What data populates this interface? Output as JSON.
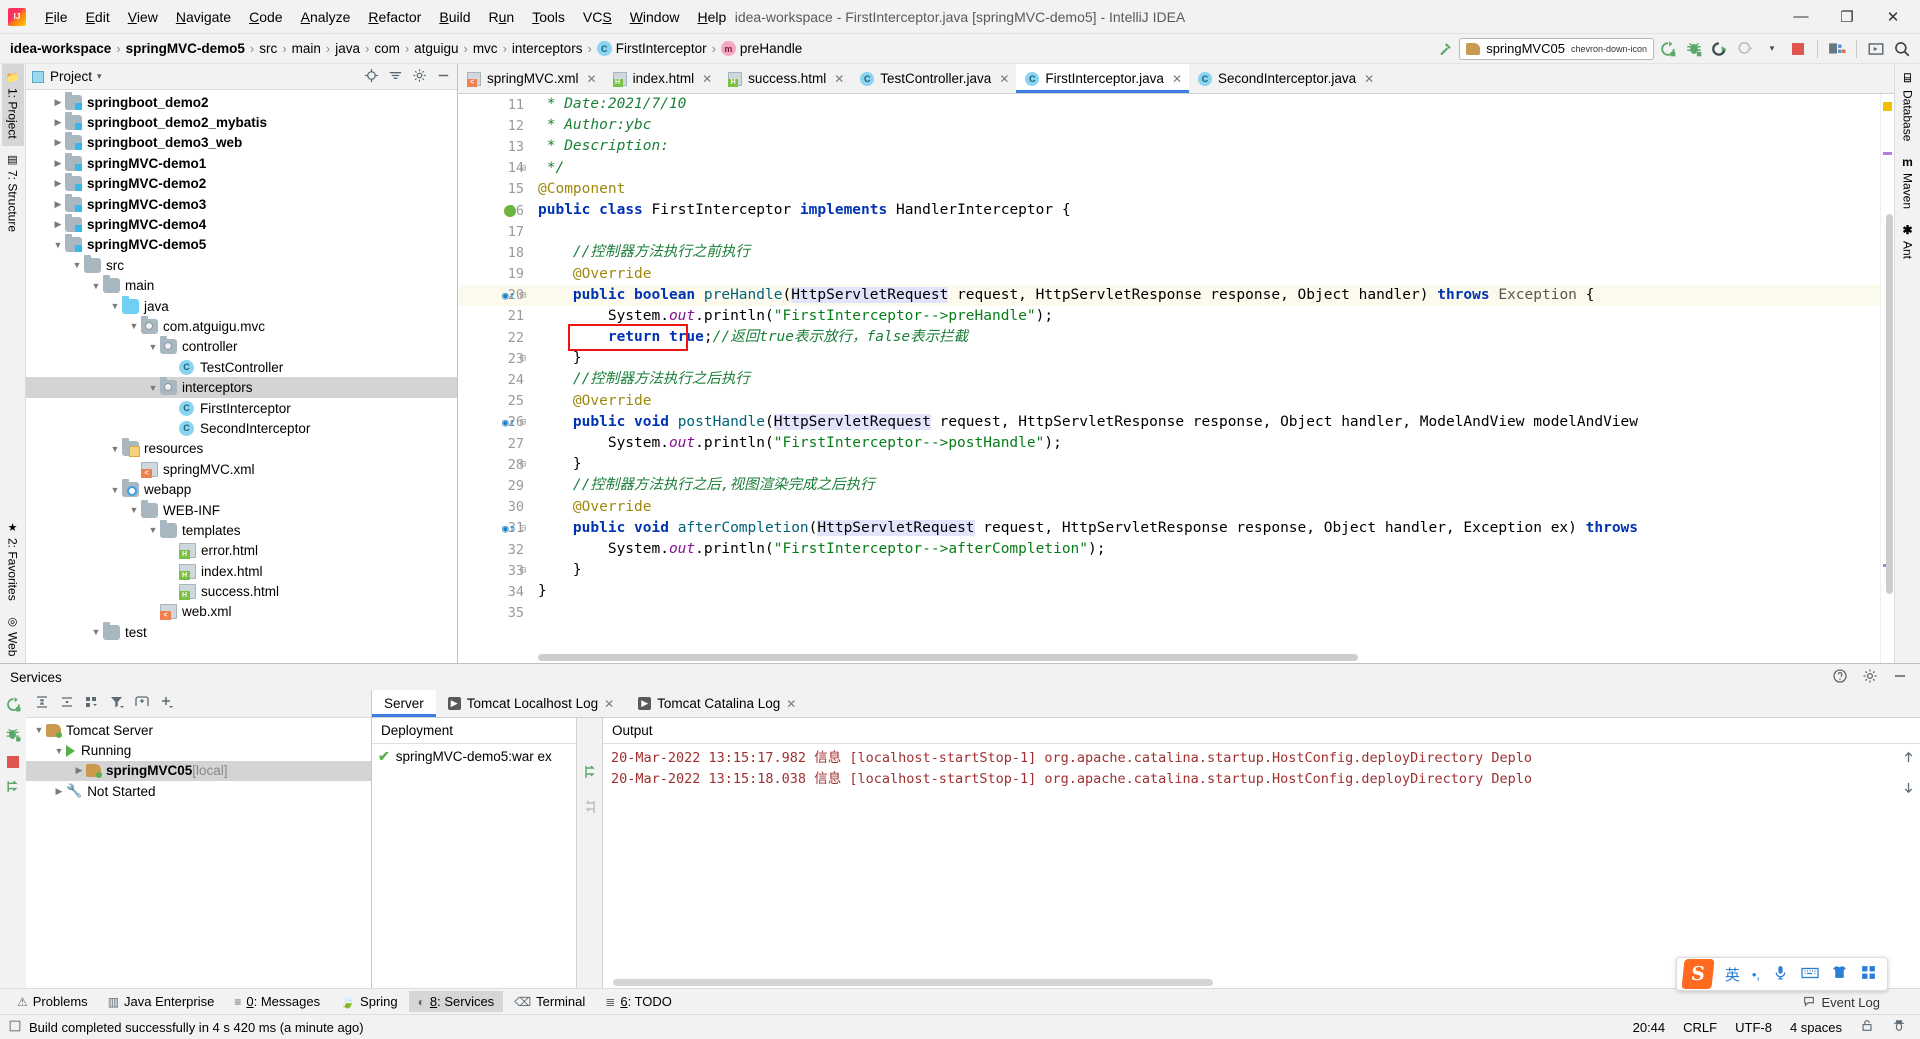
{
  "window": {
    "title": "idea-workspace - FirstInterceptor.java [springMVC-demo5] - IntelliJ IDEA",
    "minimize": "—",
    "maximize": "❐",
    "close": "✕"
  },
  "menubar": {
    "items": [
      "File",
      "Edit",
      "View",
      "Navigate",
      "Code",
      "Analyze",
      "Refactor",
      "Build",
      "Run",
      "Tools",
      "VCS",
      "Window",
      "Help"
    ]
  },
  "breadcrumb": {
    "items": [
      {
        "label": "idea-workspace",
        "bold": true,
        "icon": ""
      },
      {
        "label": "springMVC-demo5",
        "bold": true,
        "icon": ""
      },
      {
        "label": "src",
        "bold": false,
        "icon": ""
      },
      {
        "label": "main",
        "bold": false,
        "icon": ""
      },
      {
        "label": "java",
        "bold": false,
        "icon": ""
      },
      {
        "label": "com",
        "bold": false,
        "icon": ""
      },
      {
        "label": "atguigu",
        "bold": false,
        "icon": ""
      },
      {
        "label": "mvc",
        "bold": false,
        "icon": ""
      },
      {
        "label": "interceptors",
        "bold": false,
        "icon": ""
      },
      {
        "label": "FirstInterceptor",
        "bold": false,
        "icon": "class-icon"
      },
      {
        "label": "preHandle",
        "bold": false,
        "icon": "method-icon"
      }
    ]
  },
  "run_toolbar": {
    "build_icon": "hammer-icon",
    "config_name": "springMVC05",
    "config_icon": "tomcat-icon",
    "dropdown_icon": "chevron-down-icon",
    "run_icon": "run-icon",
    "debug_icon": "debug-icon",
    "run_coverage_icon": "run-with-coverage-icon",
    "profiler_icon": "profiler-icon",
    "stop_icon": "stop-icon",
    "update_icon": "update-running-app-icon",
    "layout_icon": "layout-icon",
    "search_icon": "search-everywhere-icon"
  },
  "left_rail": {
    "items": [
      {
        "label": "1: Project",
        "underline": "1",
        "active": true,
        "icon": "project-icon"
      },
      {
        "label": "7: Structure",
        "underline": "7",
        "active": false,
        "icon": "structure-icon"
      }
    ],
    "bottom_items": [
      {
        "label": "2: Favorites",
        "underline": "2",
        "icon": "star-icon"
      },
      {
        "label": "Web",
        "underline": "",
        "icon": "web-icon"
      }
    ]
  },
  "right_rail": {
    "items": [
      {
        "label": "Database",
        "icon": "database-icon"
      },
      {
        "label": "Maven",
        "icon": "maven-icon"
      },
      {
        "label": "Ant",
        "icon": "ant-icon"
      }
    ]
  },
  "project_panel": {
    "title": "Project",
    "caret": "▾",
    "actions": [
      "locate-icon",
      "collapse-all-icon",
      "settings-icon",
      "hide-icon"
    ],
    "tree": [
      {
        "depth": 1,
        "arrow": "▶",
        "icon": "module",
        "label": "springboot_demo2",
        "bold": true,
        "selected": false
      },
      {
        "depth": 1,
        "arrow": "▶",
        "icon": "module",
        "label": "springboot_demo2_mybatis",
        "bold": true,
        "selected": false
      },
      {
        "depth": 1,
        "arrow": "▶",
        "icon": "module",
        "label": "springboot_demo3_web",
        "bold": true,
        "selected": false
      },
      {
        "depth": 1,
        "arrow": "▶",
        "icon": "module",
        "label": "springMVC-demo1",
        "bold": true,
        "selected": false
      },
      {
        "depth": 1,
        "arrow": "▶",
        "icon": "module",
        "label": "springMVC-demo2",
        "bold": true,
        "selected": false
      },
      {
        "depth": 1,
        "arrow": "▶",
        "icon": "module",
        "label": "springMVC-demo3",
        "bold": true,
        "selected": false
      },
      {
        "depth": 1,
        "arrow": "▶",
        "icon": "module",
        "label": "springMVC-demo4",
        "bold": true,
        "selected": false
      },
      {
        "depth": 1,
        "arrow": "▼",
        "icon": "module",
        "label": "springMVC-demo5",
        "bold": true,
        "selected": false
      },
      {
        "depth": 2,
        "arrow": "▼",
        "icon": "folder",
        "label": "src",
        "bold": false,
        "selected": false
      },
      {
        "depth": 3,
        "arrow": "▼",
        "icon": "folder",
        "label": "main",
        "bold": false,
        "selected": false
      },
      {
        "depth": 4,
        "arrow": "▼",
        "icon": "srcfolder",
        "label": "java",
        "bold": false,
        "selected": false
      },
      {
        "depth": 5,
        "arrow": "▼",
        "icon": "pkg",
        "label": "com.atguigu.mvc",
        "bold": false,
        "selected": false
      },
      {
        "depth": 6,
        "arrow": "▼",
        "icon": "pkg",
        "label": "controller",
        "bold": false,
        "selected": false
      },
      {
        "depth": 7,
        "arrow": "",
        "icon": "cls",
        "label": "TestController",
        "bold": false,
        "selected": false
      },
      {
        "depth": 6,
        "arrow": "▼",
        "icon": "pkg",
        "label": "interceptors",
        "bold": false,
        "selected": true
      },
      {
        "depth": 7,
        "arrow": "",
        "icon": "cls",
        "label": "FirstInterceptor",
        "bold": false,
        "selected": false
      },
      {
        "depth": 7,
        "arrow": "",
        "icon": "cls",
        "label": "SecondInterceptor",
        "bold": false,
        "selected": false
      },
      {
        "depth": 4,
        "arrow": "▼",
        "icon": "res",
        "label": "resources",
        "bold": false,
        "selected": false
      },
      {
        "depth": 5,
        "arrow": "",
        "icon": "xml",
        "label": "springMVC.xml",
        "bold": false,
        "selected": false
      },
      {
        "depth": 4,
        "arrow": "▼",
        "icon": "webapp",
        "label": "webapp",
        "bold": false,
        "selected": false
      },
      {
        "depth": 5,
        "arrow": "▼",
        "icon": "folder",
        "label": "WEB-INF",
        "bold": false,
        "selected": false
      },
      {
        "depth": 6,
        "arrow": "▼",
        "icon": "folder",
        "label": "templates",
        "bold": false,
        "selected": false
      },
      {
        "depth": 7,
        "arrow": "",
        "icon": "html",
        "label": "error.html",
        "bold": false,
        "selected": false
      },
      {
        "depth": 7,
        "arrow": "",
        "icon": "html",
        "label": "index.html",
        "bold": false,
        "selected": false
      },
      {
        "depth": 7,
        "arrow": "",
        "icon": "html",
        "label": "success.html",
        "bold": false,
        "selected": false
      },
      {
        "depth": 6,
        "arrow": "",
        "icon": "xml",
        "label": "web.xml",
        "bold": false,
        "selected": false
      },
      {
        "depth": 3,
        "arrow": "▼",
        "icon": "folder",
        "label": "test",
        "bold": false,
        "selected": false
      }
    ]
  },
  "editor_tabs": [
    {
      "label": "springMVC.xml",
      "icon": "xml",
      "active": false,
      "close": "✕"
    },
    {
      "label": "index.html",
      "icon": "html",
      "active": false,
      "close": "✕"
    },
    {
      "label": "success.html",
      "icon": "html",
      "active": false,
      "close": "✕"
    },
    {
      "label": "TestController.java",
      "icon": "cls",
      "active": false,
      "close": "✕"
    },
    {
      "label": "FirstInterceptor.java",
      "icon": "cls",
      "active": true,
      "close": "✕"
    },
    {
      "label": "SecondInterceptor.java",
      "icon": "cls",
      "active": false,
      "close": "✕"
    }
  ],
  "editor": {
    "first_line_number": 11,
    "lines": [
      {
        "n": 11,
        "html": " <span class='cmt'>* Date:2021/7/10</span>"
      },
      {
        "n": 12,
        "html": " <span class='cmt'>* Author:ybc</span>"
      },
      {
        "n": 13,
        "html": " <span class='cmt'>* Description:</span>"
      },
      {
        "n": 14,
        "html": " <span class='cmt'>*/</span>",
        "fold": true
      },
      {
        "n": 15,
        "html": "<span class='anno'>@Component</span>"
      },
      {
        "n": 16,
        "html": "<span class='kw'>public</span> <span class='kw'>class</span> FirstInterceptor <span class='kw'>implements</span> HandlerInterceptor {",
        "bean": true
      },
      {
        "n": 17,
        "html": ""
      },
      {
        "n": 18,
        "html": "    <span class='cmt'>//控制器方法执行之前执行</span>"
      },
      {
        "n": 19,
        "html": "    <span class='anno'>@Override</span>"
      },
      {
        "n": 20,
        "html": "    <span class='kw'>public</span> <span class='kw'>boolean</span> <span class='fn'>preHandle</span>(<span class='hlsel'>HttpServletRequest</span> request, HttpServletResponse response, Object handler) <span class='kw'>throws</span> <span style='color:#555'>Exception</span> {",
        "hl": true,
        "override": true,
        "bulb": true,
        "fold": true
      },
      {
        "n": 21,
        "html": "        System.<span class='fld'>out</span>.println(<span class='str'>\"FirstInterceptor--&gt;preHandle\"</span>);"
      },
      {
        "n": 22,
        "html": "        <span class='kw'>return</span> <span class='kw'>true</span>;<span class='cmt'>//返回true表示放行，false表示拦截</span>"
      },
      {
        "n": 23,
        "html": "    }",
        "fold": true
      },
      {
        "n": 24,
        "html": "    <span class='cmt'>//控制器方法执行之后执行</span>"
      },
      {
        "n": 25,
        "html": "    <span class='anno'>@Override</span>"
      },
      {
        "n": 26,
        "html": "    <span class='kw'>public</span> <span class='kw'>void</span> <span class='fn'>postHandle</span>(<span class='hlsel'>HttpServletRequest</span> request, HttpServletResponse response, Object handler, ModelAndView modelAndView",
        "override": true,
        "fold": true
      },
      {
        "n": 27,
        "html": "        System.<span class='fld'>out</span>.println(<span class='str'>\"FirstInterceptor--&gt;postHandle\"</span>);"
      },
      {
        "n": 28,
        "html": "    }",
        "fold": true
      },
      {
        "n": 29,
        "html": "    <span class='cmt'>//控制器方法执行之后,视图渲染完成之后执行</span>"
      },
      {
        "n": 30,
        "html": "    <span class='anno'>@Override</span>"
      },
      {
        "n": 31,
        "html": "    <span class='kw'>public</span> <span class='kw'>void</span> <span class='fn'>afterCompletion</span>(<span class='hlsel'>HttpServletRequest</span> request, HttpServletResponse response, Object handler, Exception ex) <span class='kw'>throws</span>",
        "override": true,
        "fold": true
      },
      {
        "n": 32,
        "html": "        System.<span class='fld'>out</span>.println(<span class='str'>\"FirstInterceptor--&gt;afterCompletion\"</span>);"
      },
      {
        "n": 33,
        "html": "    }",
        "fold": true
      },
      {
        "n": 34,
        "html": "}"
      },
      {
        "n": 35,
        "html": ""
      }
    ],
    "annotation_box_line": 22
  },
  "services": {
    "title": "Services",
    "header_actions": [
      "help-icon",
      "settings-icon",
      "hide-icon"
    ],
    "left_rail_icons": [
      "rerun-icon",
      "debug-icon",
      "stop-icon",
      "deploy-icon"
    ],
    "toolbar_icons": [
      "expand-all-icon",
      "collapse-all-icon",
      "group-icon",
      "filter-icon",
      "add-tab-icon",
      "add-icon"
    ],
    "tree": [
      {
        "depth": 0,
        "arrow": "▼",
        "icon": "tomcat",
        "label": "Tomcat Server",
        "suffix": "",
        "bold": false,
        "selected": false
      },
      {
        "depth": 1,
        "arrow": "▼",
        "icon": "play",
        "label": "Running",
        "suffix": "",
        "bold": false,
        "selected": false
      },
      {
        "depth": 2,
        "arrow": "▶",
        "icon": "tomcat",
        "label": "springMVC05",
        "suffix": "[local]",
        "bold": true,
        "selected": true
      },
      {
        "depth": 1,
        "arrow": "▶",
        "icon": "wrench",
        "label": "Not Started",
        "suffix": "",
        "bold": false,
        "selected": false
      }
    ],
    "tabs": [
      {
        "label": "Server",
        "icon": "",
        "active": true,
        "close": ""
      },
      {
        "label": "Tomcat Localhost Log",
        "icon": "console-icon",
        "active": false,
        "close": "✕"
      },
      {
        "label": "Tomcat Catalina Log",
        "icon": "console-icon",
        "active": false,
        "close": "✕"
      }
    ],
    "deployment": {
      "header": "Deployment",
      "rows": [
        {
          "status": "✔",
          "label": "springMVC-demo5:war ex"
        }
      ]
    },
    "output": {
      "header": "Output",
      "lines": [
        "20-Mar-2022 13:15:17.982 信息 [localhost-startStop-1] org.apache.catalina.startup.HostConfig.deployDirectory Deplo",
        "20-Mar-2022 13:15:18.038 信息 [localhost-startStop-1] org.apache.catalina.startup.HostConfig.deployDirectory Deplo"
      ]
    }
  },
  "toolwindow_bar": {
    "items": [
      {
        "label": "Problems",
        "underline": "",
        "icon": "warning-icon",
        "active": false
      },
      {
        "label": "Java Enterprise",
        "underline": "",
        "icon": "java-enterprise-icon",
        "active": false
      },
      {
        "label": "0: Messages",
        "underline": "0",
        "icon": "messages-icon",
        "active": false
      },
      {
        "label": "Spring",
        "underline": "",
        "icon": "spring-icon",
        "active": false
      },
      {
        "label": "8: Services",
        "underline": "8",
        "icon": "services-icon",
        "active": true
      },
      {
        "label": "Terminal",
        "underline": "",
        "icon": "terminal-icon",
        "active": false
      },
      {
        "label": "6: TODO",
        "underline": "6",
        "icon": "todo-icon",
        "active": false
      }
    ],
    "event_log": "Event Log",
    "event_log_icon": "event-log-icon"
  },
  "statusbar": {
    "build_icon": "build-icon",
    "message": "Build completed successfully in 4 s 420 ms (a minute ago)",
    "time": "20:44",
    "line_separator": "CRLF",
    "encoding": "UTF-8",
    "indent": "4 spaces",
    "lock_icon": "unlocked-icon",
    "inspector_icon": "inspector-icon"
  },
  "ime_bar": {
    "logo": "S",
    "mode": "英",
    "items": [
      "•,",
      "mic-icon",
      "keyboard-icon",
      "skin-icon",
      "apps-icon"
    ]
  }
}
